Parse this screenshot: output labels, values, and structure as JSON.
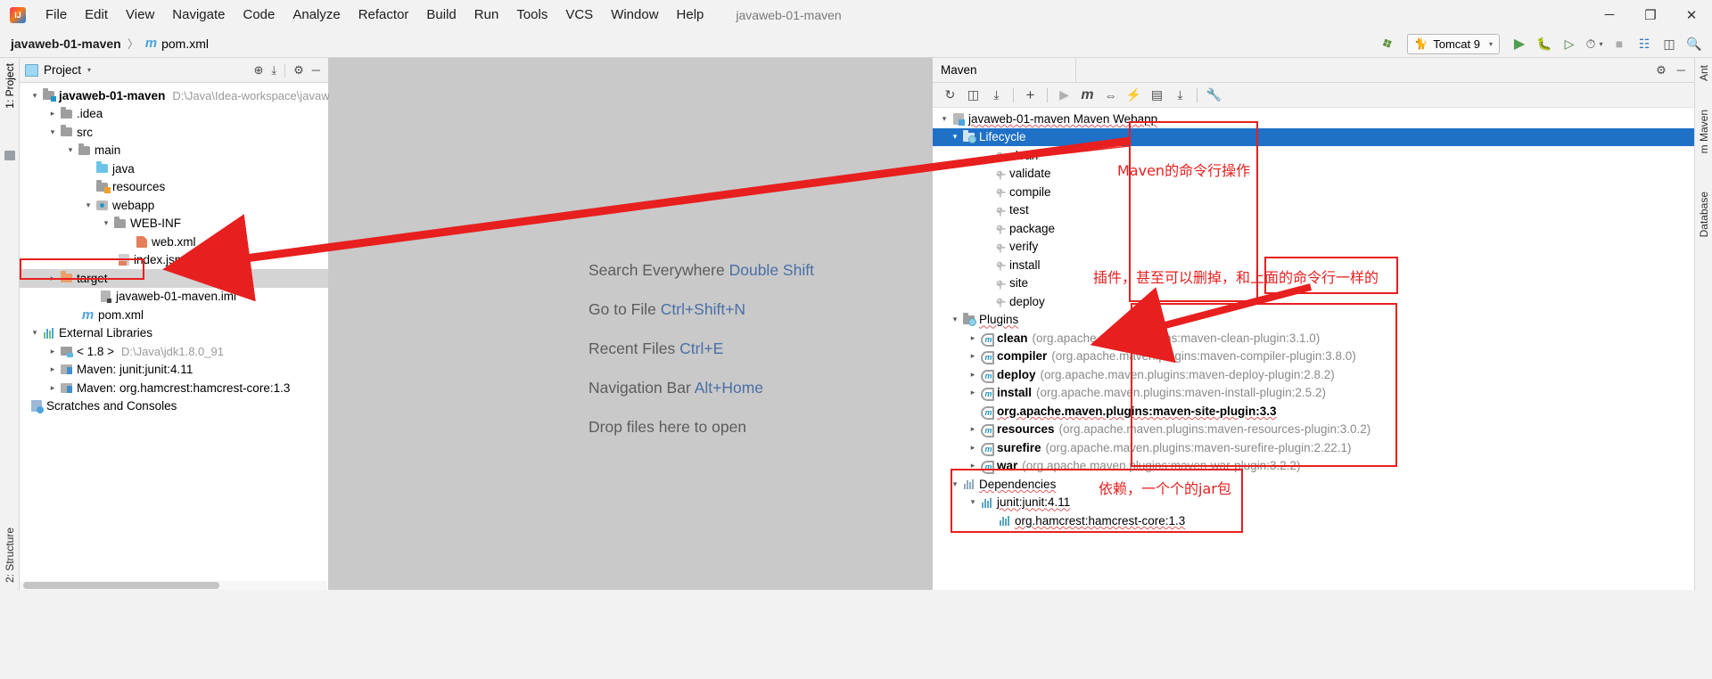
{
  "window": {
    "title": "javaweb-01-maven",
    "app_icon": "intellij-idea-icon",
    "controls": {
      "minimize": "─",
      "maximize": "❐",
      "close": "✕"
    }
  },
  "menubar": {
    "items": [
      {
        "label": "File"
      },
      {
        "label": "Edit"
      },
      {
        "label": "View"
      },
      {
        "label": "Navigate"
      },
      {
        "label": "Code"
      },
      {
        "label": "Analyze"
      },
      {
        "label": "Refactor"
      },
      {
        "label": "Build"
      },
      {
        "label": "Run"
      },
      {
        "label": "Tools"
      },
      {
        "label": "VCS"
      },
      {
        "label": "Window"
      },
      {
        "label": "Help"
      }
    ]
  },
  "navbar": {
    "breadcrumb": {
      "project": "javaweb-01-maven",
      "separator": "〉",
      "file": "pom.xml",
      "file_icon": "maven-m-icon"
    },
    "run_config": {
      "label": "Tomcat 9",
      "icon": "tomcat-cat-icon",
      "caret": "▾"
    },
    "actions": [
      {
        "name": "build-hammer-icon",
        "glyph": "⚒"
      },
      {
        "name": "run-icon",
        "glyph": "▶"
      },
      {
        "name": "debug-icon",
        "glyph": "ὁE"
      },
      {
        "name": "run-with-coverage-icon",
        "glyph": "⯈"
      },
      {
        "name": "profiler-icon",
        "glyph": "◴"
      },
      {
        "name": "stop-icon",
        "glyph": "■"
      },
      {
        "name": "update-app-icon",
        "glyph": "⊞"
      },
      {
        "name": "layout-icon",
        "glyph": "▤"
      },
      {
        "name": "search-icon",
        "glyph": "⚲"
      }
    ]
  },
  "left_strip": {
    "top_tab": "1: Project",
    "bottom_tab": "2: Structure"
  },
  "right_strip": {
    "tabs": [
      "Ant",
      "m Maven",
      "Database"
    ]
  },
  "project_panel": {
    "title": "Project",
    "title_caret": "▾",
    "header_actions": [
      {
        "name": "locate-target-icon",
        "glyph": "⊕"
      },
      {
        "name": "collapse-all-icon",
        "glyph": "⤓"
      },
      {
        "name": "settings-gear-icon",
        "glyph": "⚙"
      },
      {
        "name": "hide-panel-icon",
        "glyph": "─"
      }
    ],
    "tree": [
      {
        "depth": 0,
        "arrow": "open",
        "icon": "module-folder-icon",
        "label": "javaweb-01-maven",
        "bold": true,
        "path": "D:\\Java\\Idea-workspace\\javaw",
        "selected": false
      },
      {
        "depth": 1,
        "arrow": "closed",
        "icon": "folder-icon",
        "label": ".idea",
        "bold": false,
        "path": "",
        "selected": false
      },
      {
        "depth": 1,
        "arrow": "open",
        "icon": "folder-icon",
        "label": "src",
        "bold": false,
        "path": "",
        "selected": false
      },
      {
        "depth": 2,
        "arrow": "open",
        "icon": "folder-icon",
        "label": "main",
        "bold": false,
        "path": "",
        "selected": false
      },
      {
        "depth": 3,
        "arrow": "none",
        "icon": "source-folder-icon",
        "label": "java",
        "bold": false,
        "path": "",
        "selected": false
      },
      {
        "depth": 3,
        "arrow": "none",
        "icon": "resources-folder-icon",
        "label": "resources",
        "bold": false,
        "path": "",
        "selected": false
      },
      {
        "depth": 2,
        "arrow": "open",
        "icon": "webapp-folder-icon",
        "label": "webapp",
        "bold": false,
        "path": "",
        "selected": false
      },
      {
        "depth": 3,
        "arrow": "open",
        "icon": "folder-icon",
        "label": "WEB-INF",
        "bold": false,
        "path": "",
        "selected": false
      },
      {
        "depth": 4,
        "arrow": "none",
        "icon": "xml-file-icon",
        "label": "web.xml",
        "bold": false,
        "path": "",
        "selected": false
      },
      {
        "depth": 3,
        "arrow": "none",
        "icon": "jsp-file-icon",
        "label": "index.jsp",
        "bold": false,
        "path": "",
        "selected": false
      },
      {
        "depth": 1,
        "arrow": "closed",
        "icon": "target-folder-icon",
        "label": "target",
        "bold": false,
        "path": "",
        "selected": true
      },
      {
        "depth": 2,
        "arrow": "none",
        "icon": "iml-file-icon",
        "label": "javaweb-01-maven.iml",
        "bold": false,
        "path": "",
        "selected": false
      },
      {
        "depth": 1,
        "arrow": "none",
        "icon": "maven-m-icon",
        "label": "pom.xml",
        "bold": false,
        "path": "",
        "selected": false
      },
      {
        "depth": 0,
        "arrow": "open",
        "icon": "external-libraries-icon",
        "label": "External Libraries",
        "bold": false,
        "path": "",
        "selected": false
      },
      {
        "depth": 1,
        "arrow": "closed",
        "icon": "jdk-icon",
        "label": "< 1.8 >",
        "bold": false,
        "path": "D:\\Java\\jdk1.8.0_91",
        "selected": false
      },
      {
        "depth": 1,
        "arrow": "closed",
        "icon": "library-icon",
        "label": "Maven: junit:junit:4.11",
        "bold": false,
        "path": "",
        "selected": false
      },
      {
        "depth": 1,
        "arrow": "closed",
        "icon": "library-icon",
        "label": "Maven: org.hamcrest:hamcrest-core:1.3",
        "bold": false,
        "path": "",
        "selected": false
      },
      {
        "depth": 0,
        "arrow": "none",
        "icon": "scratches-icon",
        "label": "Scratches and Consoles",
        "bold": false,
        "path": "",
        "selected": false
      }
    ]
  },
  "editor": {
    "hints": [
      {
        "label": "Search Everywhere",
        "shortcut": "Double Shift"
      },
      {
        "label": "Go to File",
        "shortcut": "Ctrl+Shift+N"
      },
      {
        "label": "Recent Files",
        "shortcut": "Ctrl+E"
      },
      {
        "label": "Navigation Bar",
        "shortcut": "Alt+Home"
      },
      {
        "label": "Drop files here to open",
        "shortcut": ""
      }
    ]
  },
  "maven_panel": {
    "title": "Maven",
    "header_actions": [
      {
        "name": "settings-gear-icon",
        "glyph": "⚙"
      },
      {
        "name": "hide-panel-icon",
        "glyph": "─"
      }
    ],
    "toolbar": [
      {
        "name": "reimport-icon",
        "glyph": "↻",
        "dim": false
      },
      {
        "name": "generate-sources-icon",
        "glyph": "◱",
        "dim": false
      },
      {
        "name": "download-sources-icon",
        "glyph": "⤓",
        "dim": false
      },
      {
        "name": "add-maven-project-icon",
        "glyph": "＋",
        "dim": false
      },
      {
        "name": "run-goal-icon",
        "glyph": "▶",
        "dim": true
      },
      {
        "name": "execute-maven-goal-icon",
        "glyph": "m",
        "dim": false
      },
      {
        "name": "toggle-skip-tests-icon",
        "glyph": "⫼",
        "dim": false
      },
      {
        "name": "toggle-offline-icon",
        "glyph": "⚡",
        "dim": false
      },
      {
        "name": "show-dependencies-icon",
        "glyph": "⌸",
        "dim": false
      },
      {
        "name": "collapse-all-icon",
        "glyph": "⤓",
        "dim": false
      },
      {
        "name": "maven-settings-icon",
        "glyph": "⚒",
        "dim": false
      }
    ],
    "tree": {
      "root": {
        "label": "javaweb-01-maven Maven Webapp",
        "icon": "maven-project-icon",
        "arrow": "open"
      },
      "lifecycle": {
        "label": "Lifecycle",
        "icon": "lifecycle-folder-icon",
        "arrow": "open",
        "selected": true,
        "goals": [
          "clean",
          "validate",
          "compile",
          "test",
          "package",
          "verify",
          "install",
          "site",
          "deploy"
        ]
      },
      "plugins": {
        "label": "Plugins",
        "icon": "plugins-folder-icon",
        "arrow": "open",
        "items": [
          {
            "name": "clean",
            "coords": "(org.apache.maven.plugins:maven-clean-plugin:3.1.0)",
            "arrow": "closed",
            "full_only": false
          },
          {
            "name": "compiler",
            "coords": "(org.apache.maven.plugins:maven-compiler-plugin:3.8.0)",
            "arrow": "closed",
            "full_only": false
          },
          {
            "name": "deploy",
            "coords": "(org.apache.maven.plugins:maven-deploy-plugin:2.8.2)",
            "arrow": "closed",
            "full_only": false
          },
          {
            "name": "install",
            "coords": "(org.apache.maven.plugins:maven-install-plugin:2.5.2)",
            "arrow": "closed",
            "full_only": false
          },
          {
            "name": "org.apache.maven.plugins:maven-site-plugin:3.3",
            "coords": "",
            "arrow": "none",
            "full_only": true
          },
          {
            "name": "resources",
            "coords": "(org.apache.maven.plugins:maven-resources-plugin:3.0.2)",
            "arrow": "closed",
            "full_only": false
          },
          {
            "name": "surefire",
            "coords": "(org.apache.maven.plugins:maven-surefire-plugin:2.22.1)",
            "arrow": "closed",
            "full_only": false
          },
          {
            "name": "war",
            "coords": "(org.apache.maven.plugins:maven-war-plugin:3.2.2)",
            "arrow": "closed",
            "full_only": false
          }
        ]
      },
      "dependencies": {
        "label": "Dependencies",
        "icon": "dependencies-icon",
        "arrow": "open",
        "items": [
          {
            "label": "junit:junit:4.11",
            "arrow": "open",
            "depth": 0
          },
          {
            "label": "org.hamcrest:hamcrest-core:1.3",
            "arrow": "none",
            "depth": 1
          }
        ]
      }
    }
  },
  "annotations": {
    "color": "#e81f1f",
    "notes": [
      {
        "name": "maven-command-line-note",
        "text": "Maven的命令行操作"
      },
      {
        "name": "plugins-note",
        "text": "插件，甚至可以删掉，和上面的命令行一样的"
      },
      {
        "name": "dependencies-note",
        "text": "依赖，一个个的jar包"
      }
    ]
  }
}
